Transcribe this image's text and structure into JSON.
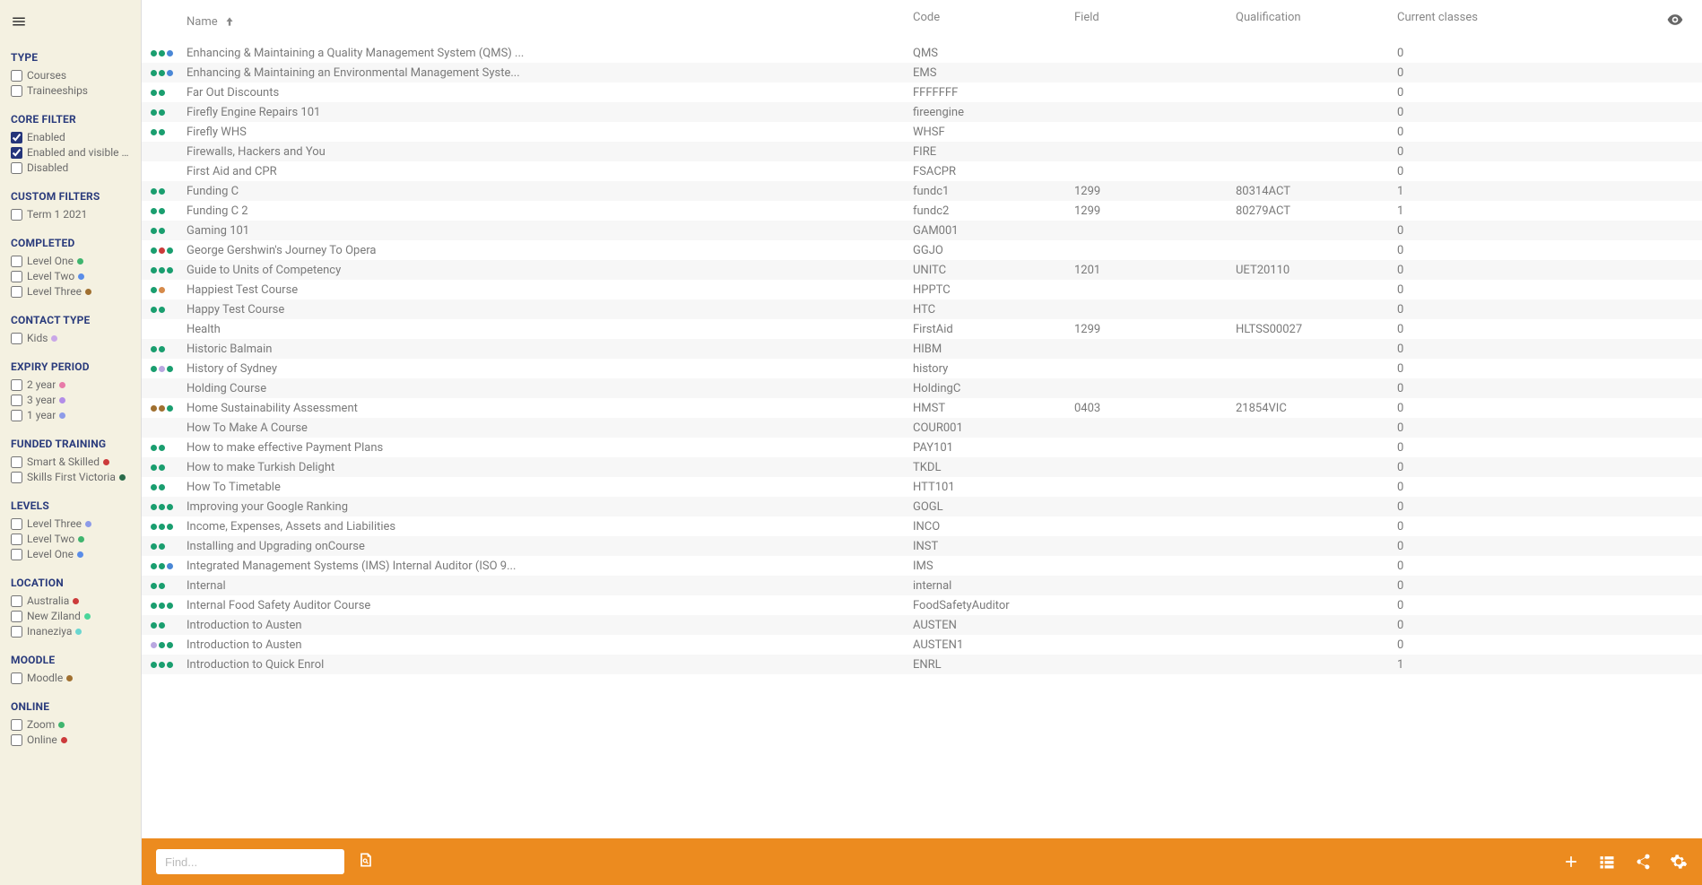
{
  "sidebar": {
    "groups": [
      {
        "title": "TYPE",
        "items": [
          {
            "label": "Courses",
            "checked": false
          },
          {
            "label": "Traineeships",
            "checked": false
          }
        ]
      },
      {
        "title": "CORE FILTER",
        "items": [
          {
            "label": "Enabled",
            "checked": true
          },
          {
            "label": "Enabled and visible on...",
            "checked": true
          },
          {
            "label": "Disabled",
            "checked": false
          }
        ]
      },
      {
        "title": "CUSTOM FILTERS",
        "items": [
          {
            "label": "Term 1 2021",
            "checked": false
          }
        ]
      },
      {
        "title": "COMPLETED",
        "items": [
          {
            "label": "Level One",
            "checked": false,
            "dot": "#3fb56e"
          },
          {
            "label": "Level Two",
            "checked": false,
            "dot": "#5a8de8"
          },
          {
            "label": "Level Three",
            "checked": false,
            "dot": "#a07030"
          }
        ]
      },
      {
        "title": "CONTACT TYPE",
        "items": [
          {
            "label": "Kids",
            "checked": false,
            "dot": "#c9a7e8"
          }
        ]
      },
      {
        "title": "EXPIRY PERIOD",
        "items": [
          {
            "label": "2 year",
            "checked": false,
            "dot": "#e87aa8"
          },
          {
            "label": "3 year",
            "checked": false,
            "dot": "#b28de8"
          },
          {
            "label": "1 year",
            "checked": false,
            "dot": "#8d9be8"
          }
        ]
      },
      {
        "title": "FUNDED TRAINING",
        "items": [
          {
            "label": "Smart & Skilled",
            "checked": false,
            "dot": "#cc3b3b"
          },
          {
            "label": "Skills First Victoria",
            "checked": false,
            "dot": "#2a6b4a"
          }
        ]
      },
      {
        "title": "LEVELS",
        "items": [
          {
            "label": "Level Three",
            "checked": false,
            "dot": "#8d9be8"
          },
          {
            "label": "Level Two",
            "checked": false,
            "dot": "#3fb56e"
          },
          {
            "label": "Level One",
            "checked": false,
            "dot": "#5a8de8"
          }
        ]
      },
      {
        "title": "LOCATION",
        "items": [
          {
            "label": "Australia",
            "checked": false,
            "dot": "#cc3b3b"
          },
          {
            "label": "New Ziland",
            "checked": false,
            "dot": "#4ad69a"
          },
          {
            "label": "Inaneziya",
            "checked": false,
            "dot": "#6ad6d0"
          }
        ]
      },
      {
        "title": "MOODLE",
        "items": [
          {
            "label": "Moodle",
            "checked": false,
            "dot": "#a07030"
          }
        ]
      },
      {
        "title": "ONLINE",
        "items": [
          {
            "label": "Zoom",
            "checked": false,
            "dot": "#3fb56e"
          },
          {
            "label": "Online",
            "checked": false,
            "dot": "#cc3b3b"
          }
        ]
      }
    ]
  },
  "columns": {
    "name": "Name",
    "code": "Code",
    "field": "Field",
    "qualification": "Qualification",
    "classes": "Current classes"
  },
  "rows": [
    {
      "dots": [
        "#1a9e6f",
        "#1a9e6f",
        "#4a87d6"
      ],
      "name": "Enhancing & Maintaining a Quality Management System (QMS) ...",
      "code": "QMS",
      "field": "",
      "qual": "",
      "classes": "0"
    },
    {
      "dots": [
        "#1a9e6f",
        "#1a9e6f",
        "#4a87d6"
      ],
      "name": "Enhancing & Maintaining an Environmental Management Syste...",
      "code": "EMS",
      "field": "",
      "qual": "",
      "classes": "0"
    },
    {
      "dots": [
        "#1a9e6f",
        "#1a9e6f"
      ],
      "name": "Far Out Discounts",
      "code": "FFFFFFF",
      "field": "",
      "qual": "",
      "classes": "0"
    },
    {
      "dots": [
        "#1a9e6f",
        "#1a9e6f"
      ],
      "name": "Firefly Engine Repairs 101",
      "code": "fireengine",
      "field": "",
      "qual": "",
      "classes": "0"
    },
    {
      "dots": [
        "#1a9e6f",
        "#1a9e6f"
      ],
      "name": "Firefly WHS",
      "code": "WHSF",
      "field": "",
      "qual": "",
      "classes": "0"
    },
    {
      "dots": [],
      "name": "Firewalls, Hackers and You",
      "code": "FIRE",
      "field": "",
      "qual": "",
      "classes": "0"
    },
    {
      "dots": [],
      "name": "First Aid and CPR",
      "code": "FSACPR",
      "field": "",
      "qual": "",
      "classes": "0"
    },
    {
      "dots": [
        "#1a9e6f",
        "#1a9e6f"
      ],
      "name": "Funding C",
      "code": "fundc1",
      "field": "1299",
      "qual": "80314ACT",
      "classes": "1"
    },
    {
      "dots": [
        "#1a9e6f",
        "#1a9e6f"
      ],
      "name": "Funding C 2",
      "code": "fundc2",
      "field": "1299",
      "qual": "80279ACT",
      "classes": "1"
    },
    {
      "dots": [
        "#1a9e6f",
        "#1a9e6f"
      ],
      "name": "Gaming 101",
      "code": "GAM001",
      "field": "",
      "qual": "",
      "classes": "0"
    },
    {
      "dots": [
        "#1a9e6f",
        "#cc3b3b",
        "#1a9e6f"
      ],
      "name": "George Gershwin's Journey To Opera",
      "code": "GGJO",
      "field": "",
      "qual": "",
      "classes": "0"
    },
    {
      "dots": [
        "#1a9e6f",
        "#1a9e6f",
        "#1a9e6f"
      ],
      "name": "Guide to Units of Competency",
      "code": "UNITC",
      "field": "1201",
      "qual": "UET20110",
      "classes": "0"
    },
    {
      "dots": [
        "#1a9e6f",
        "#d68a4a"
      ],
      "name": "Happiest Test Course",
      "code": "HPPTC",
      "field": "",
      "qual": "",
      "classes": "0"
    },
    {
      "dots": [
        "#1a9e6f",
        "#1a9e6f"
      ],
      "name": "Happy Test Course",
      "code": "HTC",
      "field": "",
      "qual": "",
      "classes": "0"
    },
    {
      "dots": [],
      "name": "Health",
      "code": "FirstAid",
      "field": "1299",
      "qual": "HLTSS00027",
      "classes": "0"
    },
    {
      "dots": [
        "#1a9e6f",
        "#1a9e6f"
      ],
      "name": "Historic Balmain",
      "code": "HIBM",
      "field": "",
      "qual": "",
      "classes": "0"
    },
    {
      "dots": [
        "#1a9e6f",
        "#b9a7e0",
        "#1a9e6f"
      ],
      "name": "History of Sydney",
      "code": "history",
      "field": "",
      "qual": "",
      "classes": "0"
    },
    {
      "dots": [],
      "name": "Holding Course",
      "code": "HoldingC",
      "field": "",
      "qual": "",
      "classes": "0"
    },
    {
      "dots": [
        "#a07030",
        "#a07030",
        "#1a9e6f"
      ],
      "name": "Home Sustainability Assessment",
      "code": "HMST",
      "field": "0403",
      "qual": "21854VIC",
      "classes": "0"
    },
    {
      "dots": [],
      "name": "How To Make A Course",
      "code": "COUR001",
      "field": "",
      "qual": "",
      "classes": "0"
    },
    {
      "dots": [
        "#1a9e6f",
        "#1a9e6f"
      ],
      "name": "How to make effective Payment Plans",
      "code": "PAY101",
      "field": "",
      "qual": "",
      "classes": "0"
    },
    {
      "dots": [
        "#1a9e6f",
        "#1a9e6f"
      ],
      "name": "How to make Turkish Delight",
      "code": "TKDL",
      "field": "",
      "qual": "",
      "classes": "0"
    },
    {
      "dots": [
        "#1a9e6f",
        "#1a9e6f"
      ],
      "name": "How To Timetable",
      "code": "HTT101",
      "field": "",
      "qual": "",
      "classes": "0"
    },
    {
      "dots": [
        "#1a9e6f",
        "#1a9e6f",
        "#1a9e6f"
      ],
      "name": "Improving your Google Ranking",
      "code": "GOGL",
      "field": "",
      "qual": "",
      "classes": "0"
    },
    {
      "dots": [
        "#1a9e6f",
        "#1a9e6f",
        "#1a9e6f"
      ],
      "name": "Income, Expenses, Assets and Liabilities",
      "code": "INCO",
      "field": "",
      "qual": "",
      "classes": "0"
    },
    {
      "dots": [
        "#1a9e6f",
        "#1a9e6f"
      ],
      "name": "Installing and Upgrading onCourse",
      "code": "INST",
      "field": "",
      "qual": "",
      "classes": "0"
    },
    {
      "dots": [
        "#1a9e6f",
        "#1a9e6f",
        "#4a87d6"
      ],
      "name": "Integrated Management Systems (IMS) Internal Auditor (ISO 9...",
      "code": "IMS",
      "field": "",
      "qual": "",
      "classes": "0"
    },
    {
      "dots": [
        "#1a9e6f",
        "#1a9e6f"
      ],
      "name": "Internal",
      "code": "internal",
      "field": "",
      "qual": "",
      "classes": "0"
    },
    {
      "dots": [
        "#1a9e6f",
        "#1a9e6f",
        "#1a9e6f"
      ],
      "name": "Internal Food Safety Auditor Course",
      "code": "FoodSafetyAuditor",
      "field": "",
      "qual": "",
      "classes": "0"
    },
    {
      "dots": [
        "#1a9e6f",
        "#1a9e6f"
      ],
      "name": "Introduction to Austen",
      "code": "AUSTEN",
      "field": "",
      "qual": "",
      "classes": "0"
    },
    {
      "dots": [
        "#b9a7e0",
        "#1a9e6f",
        "#1a9e6f"
      ],
      "name": "Introduction to Austen",
      "code": "AUSTEN1",
      "field": "",
      "qual": "",
      "classes": "0"
    },
    {
      "dots": [
        "#1a9e6f",
        "#1a9e6f",
        "#1a9e6f"
      ],
      "name": "Introduction to Quick Enrol",
      "code": "ENRL",
      "field": "",
      "qual": "",
      "classes": "1"
    }
  ],
  "search": {
    "placeholder": "Find..."
  }
}
